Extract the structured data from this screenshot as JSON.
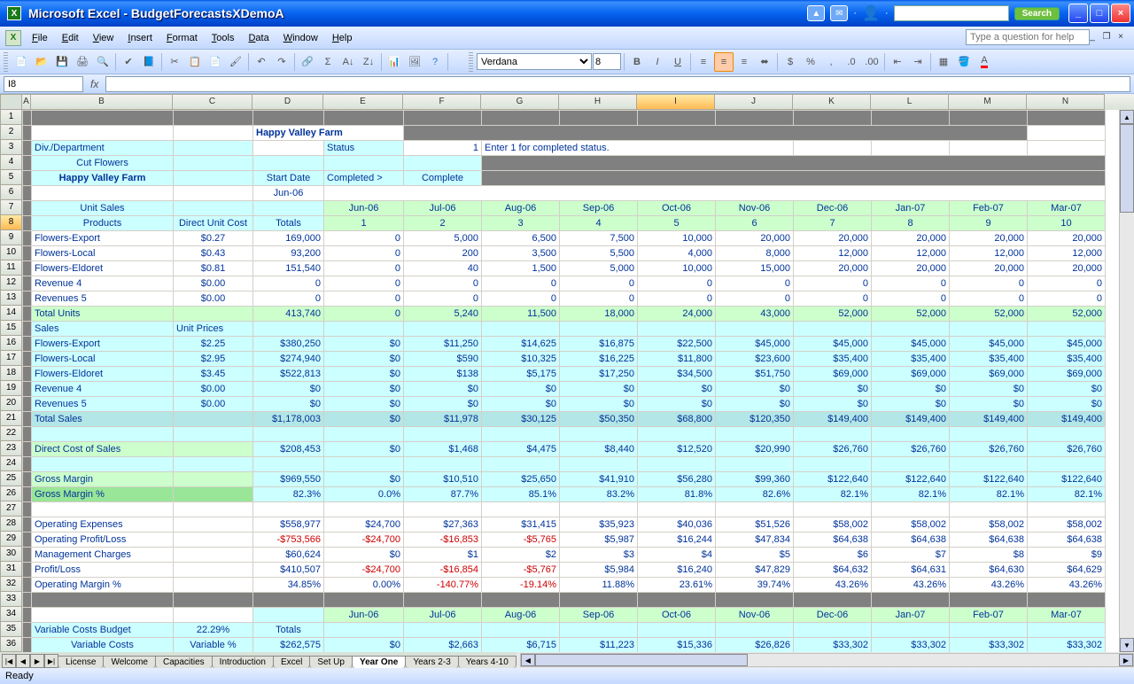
{
  "app": {
    "title": "Microsoft Excel - BudgetForecastsXDemoA",
    "search_btn": "Search",
    "help_placeholder": "Type a question for help"
  },
  "menu": [
    "File",
    "Edit",
    "View",
    "Insert",
    "Format",
    "Tools",
    "Data",
    "Window",
    "Help"
  ],
  "formula": {
    "namebox": "I8",
    "fx": ""
  },
  "font": {
    "name": "Verdana",
    "size": "8"
  },
  "cols": [
    "A",
    "B",
    "C",
    "D",
    "E",
    "F",
    "G",
    "H",
    "I",
    "J",
    "K",
    "L",
    "M",
    "N"
  ],
  "colwidths": {
    "A": 10,
    "B": 160,
    "C": 90,
    "D": 80,
    "E": 90,
    "F": 88,
    "G": 88,
    "H": 88,
    "I": 88,
    "J": 88,
    "K": 88,
    "L": 88,
    "M": 88,
    "N": 88
  },
  "rows_visible": 36,
  "selected_col": "I",
  "selected_row": 8,
  "labels": {
    "hdr_title": "Happy Valley Farm",
    "div_dept": "Div./Department",
    "cut_flowers": "Cut Flowers",
    "farm": "Happy Valley Farm",
    "status": "Status",
    "status_val": "1",
    "status_hint": "Enter 1 for completed status.",
    "start_date": "Start Date",
    "jun06": "Jun-06",
    "completed_arrow": "Completed >",
    "complete": "Complete",
    "unit_sales": "Unit Sales",
    "direct_unit_cost": "Direct Unit Cost",
    "totals": "Totals",
    "products": "Products",
    "sales": "Sales",
    "unit_prices": "Unit Prices",
    "total_units": "Total Units",
    "total_sales": "Total Sales",
    "direct_cost_sales": "Direct Cost of Sales",
    "gross_margin": "Gross Margin",
    "gross_margin_pct": "Gross Margin %",
    "op_exp": "Operating Expenses",
    "op_pl": "Operating Profit/Loss",
    "mgmt_chg": "Management Charges",
    "pl": "Profit/Loss",
    "op_mgn_pct": "Operating Margin %",
    "var_costs_budget": "Variable Costs Budget",
    "var_costs": "Variable Costs",
    "variable_pct": "Variable %"
  },
  "months": [
    "Jun-06",
    "Jul-06",
    "Aug-06",
    "Sep-06",
    "Oct-06",
    "Nov-06",
    "Dec-06",
    "Jan-07",
    "Feb-07",
    "Mar-07"
  ],
  "month_nums": [
    "1",
    "2",
    "3",
    "4",
    "5",
    "6",
    "7",
    "8",
    "9",
    "10"
  ],
  "products": [
    {
      "name": "Flowers-Export",
      "duc": "$0.27",
      "total": "169,000",
      "vals": [
        "0",
        "5,000",
        "6,500",
        "7,500",
        "10,000",
        "20,000",
        "20,000",
        "20,000",
        "20,000",
        "20,000"
      ]
    },
    {
      "name": "Flowers-Local",
      "duc": "$0.43",
      "total": "93,200",
      "vals": [
        "0",
        "200",
        "3,500",
        "5,500",
        "4,000",
        "8,000",
        "12,000",
        "12,000",
        "12,000",
        "12,000"
      ]
    },
    {
      "name": "Flowers-Eldoret",
      "duc": "$0.81",
      "total": "151,540",
      "vals": [
        "0",
        "40",
        "1,500",
        "5,000",
        "10,000",
        "15,000",
        "20,000",
        "20,000",
        "20,000",
        "20,000"
      ]
    },
    {
      "name": "Revenue 4",
      "duc": "$0.00",
      "total": "0",
      "vals": [
        "0",
        "0",
        "0",
        "0",
        "0",
        "0",
        "0",
        "0",
        "0",
        "0"
      ]
    },
    {
      "name": "Revenues 5",
      "duc": "$0.00",
      "total": "0",
      "vals": [
        "0",
        "0",
        "0",
        "0",
        "0",
        "0",
        "0",
        "0",
        "0",
        "0"
      ]
    }
  ],
  "total_units_row": {
    "total": "413,740",
    "vals": [
      "0",
      "5,240",
      "11,500",
      "18,000",
      "24,000",
      "43,000",
      "52,000",
      "52,000",
      "52,000",
      "52,000"
    ]
  },
  "sales_rows": [
    {
      "name": "Flowers-Export",
      "price": "$2.25",
      "total": "$380,250",
      "vals": [
        "$0",
        "$11,250",
        "$14,625",
        "$16,875",
        "$22,500",
        "$45,000",
        "$45,000",
        "$45,000",
        "$45,000",
        "$45,000"
      ]
    },
    {
      "name": "Flowers-Local",
      "price": "$2.95",
      "total": "$274,940",
      "vals": [
        "$0",
        "$590",
        "$10,325",
        "$16,225",
        "$11,800",
        "$23,600",
        "$35,400",
        "$35,400",
        "$35,400",
        "$35,400"
      ]
    },
    {
      "name": "Flowers-Eldoret",
      "price": "$3.45",
      "total": "$522,813",
      "vals": [
        "$0",
        "$138",
        "$5,175",
        "$17,250",
        "$34,500",
        "$51,750",
        "$69,000",
        "$69,000",
        "$69,000",
        "$69,000"
      ]
    },
    {
      "name": "Revenue 4",
      "price": "$0.00",
      "total": "$0",
      "vals": [
        "$0",
        "$0",
        "$0",
        "$0",
        "$0",
        "$0",
        "$0",
        "$0",
        "$0",
        "$0"
      ]
    },
    {
      "name": "Revenues 5",
      "price": "$0.00",
      "total": "$0",
      "vals": [
        "$0",
        "$0",
        "$0",
        "$0",
        "$0",
        "$0",
        "$0",
        "$0",
        "$0",
        "$0"
      ]
    }
  ],
  "total_sales_row": {
    "total": "$1,178,003",
    "vals": [
      "$0",
      "$11,978",
      "$30,125",
      "$50,350",
      "$68,800",
      "$120,350",
      "$149,400",
      "$149,400",
      "$149,400",
      "$149,400"
    ]
  },
  "direct_cost_row": {
    "total": "$208,453",
    "vals": [
      "$0",
      "$1,468",
      "$4,475",
      "$8,440",
      "$12,520",
      "$20,990",
      "$26,760",
      "$26,760",
      "$26,760",
      "$26,760"
    ]
  },
  "gross_margin_row": {
    "total": "$969,550",
    "vals": [
      "$0",
      "$10,510",
      "$25,650",
      "$41,910",
      "$56,280",
      "$99,360",
      "$122,640",
      "$122,640",
      "$122,640",
      "$122,640"
    ]
  },
  "gross_margin_pct_row": {
    "total": "82.3%",
    "vals": [
      "0.0%",
      "87.7%",
      "85.1%",
      "83.2%",
      "81.8%",
      "82.6%",
      "82.1%",
      "82.1%",
      "82.1%",
      "82.1%"
    ]
  },
  "op_exp_row": {
    "total": "$558,977",
    "vals": [
      "$24,700",
      "$27,363",
      "$31,415",
      "$35,923",
      "$40,036",
      "$51,526",
      "$58,002",
      "$58,002",
      "$58,002",
      "$58,002"
    ]
  },
  "op_pl_row": {
    "total": "-$753,566",
    "vals": [
      "-$24,700",
      "-$16,853",
      "-$5,765",
      "$5,987",
      "$16,244",
      "$47,834",
      "$64,638",
      "$64,638",
      "$64,638",
      "$64,638"
    ],
    "neg": [
      0,
      1,
      2,
      3
    ]
  },
  "mgmt_row": {
    "total": "$60,624",
    "vals": [
      "$0",
      "$1",
      "$2",
      "$3",
      "$4",
      "$5",
      "$6",
      "$7",
      "$8",
      "$9"
    ]
  },
  "pl_row": {
    "total": "$410,507",
    "vals": [
      "-$24,700",
      "-$16,854",
      "-$5,767",
      "$5,984",
      "$16,240",
      "$47,829",
      "$64,632",
      "$64,631",
      "$64,630",
      "$64,629"
    ],
    "neg": [
      1,
      2,
      3
    ]
  },
  "op_mgn_row": {
    "total": "34.85%",
    "vals": [
      "0.00%",
      "-140.77%",
      "-19.14%",
      "11.88%",
      "23.61%",
      "39.74%",
      "43.26%",
      "43.26%",
      "43.26%",
      "43.26%"
    ],
    "neg": [
      2,
      3
    ]
  },
  "var_budget_pct": "22.29%",
  "var_costs_row": {
    "total": "$262,575",
    "vals": [
      "$0",
      "$2,663",
      "$6,715",
      "$11,223",
      "$15,336",
      "$26,826",
      "$33,302",
      "$33,302",
      "$33,302",
      "$33,302"
    ]
  },
  "tabs": [
    "License",
    "Welcome",
    "Capacities",
    "Introduction",
    "Excel",
    "Set Up",
    "Year One",
    "Years 2-3",
    "Years 4-10"
  ],
  "active_tab": "Year One",
  "status": "Ready"
}
